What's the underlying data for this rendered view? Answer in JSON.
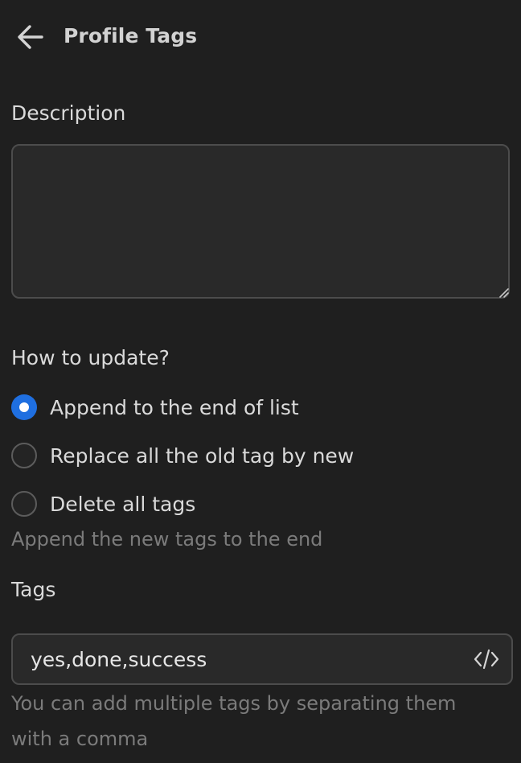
{
  "header": {
    "back_icon": "arrow-left-icon",
    "title": "Profile Tags"
  },
  "description": {
    "label": "Description",
    "value": "",
    "placeholder": ""
  },
  "update_mode": {
    "label": "How to update?",
    "options": [
      {
        "label": "Append to the end of list",
        "selected": true
      },
      {
        "label": "Replace all the old tag by new",
        "selected": false
      },
      {
        "label": "Delete all tags",
        "selected": false
      }
    ],
    "hint": "Append the new tags to the end"
  },
  "tags": {
    "label": "Tags",
    "value": "yes,done,success",
    "code_icon": "code-icon",
    "hint": "You can add multiple tags by separating them with a comma"
  },
  "colors": {
    "background": "#1f1f1f",
    "accent": "#1f6fe0",
    "hint_text": "#7b7b7b"
  }
}
